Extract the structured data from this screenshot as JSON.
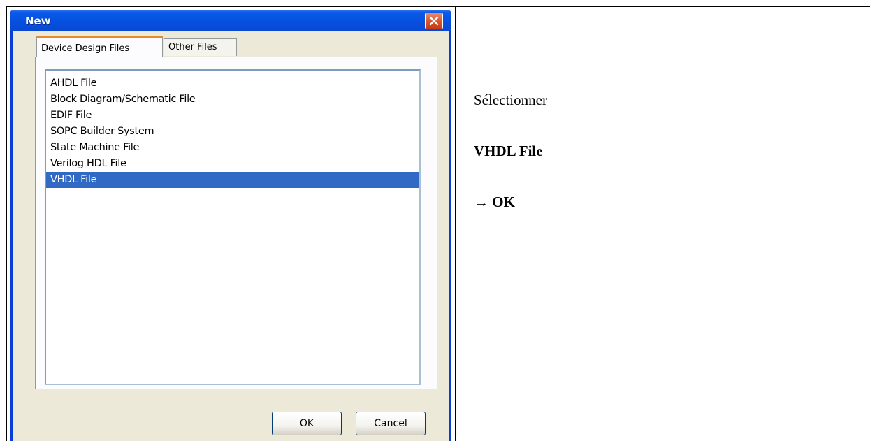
{
  "dialog": {
    "title": "New",
    "tabs": [
      {
        "label": "Device Design Files",
        "active": true
      },
      {
        "label": "Other Files",
        "active": false
      }
    ],
    "file_types": [
      {
        "label": "AHDL File",
        "selected": false
      },
      {
        "label": "Block Diagram/Schematic File",
        "selected": false
      },
      {
        "label": "EDIF File",
        "selected": false
      },
      {
        "label": "SOPC Builder System",
        "selected": false
      },
      {
        "label": "State Machine File",
        "selected": false
      },
      {
        "label": "Verilog HDL File",
        "selected": false
      },
      {
        "label": "VHDL File",
        "selected": true
      }
    ],
    "ok_label": "OK",
    "cancel_label": "Cancel"
  },
  "instructions": {
    "line1": "Sélectionner",
    "line2": "VHDL File",
    "line3": "→ OK"
  },
  "colors": {
    "title_bar": "#0550e0",
    "selection": "#316ac5",
    "dialog_face": "#ece9d8",
    "close_button": "#d9572f"
  }
}
